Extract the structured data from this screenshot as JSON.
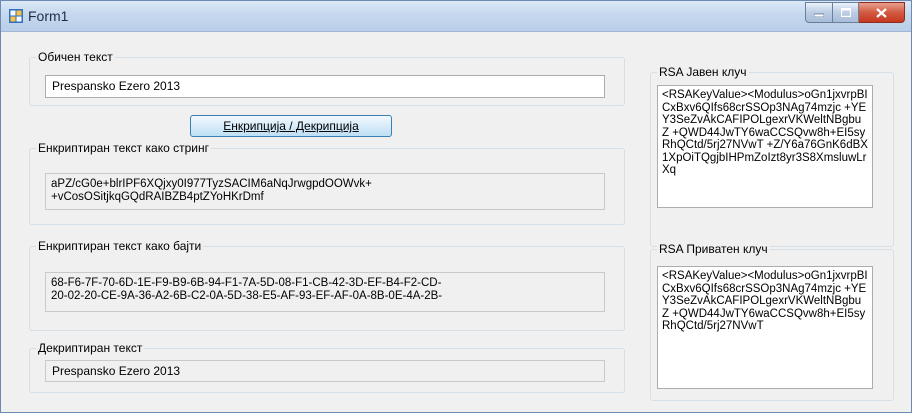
{
  "window": {
    "title": "Form1"
  },
  "plain_group": {
    "label": "Обичен текст",
    "value": "Prespansko Ezero 2013"
  },
  "encrypt_button": {
    "label": "Енкрипциjа / Декрипциjа"
  },
  "encrypted_string_group": {
    "label": "Енкриптиран текст како стринг",
    "lines": [
      "aPZ/cG0e+blrIPF6XQjxy0I977TyzSACIM6aNqJrwgpdOOWvk+",
      "+vCosOSitjkqGQdRAIBZB4ptZYoHKrDmf"
    ]
  },
  "encrypted_bytes_group": {
    "label": "Енкриптиран текст како бајти",
    "lines": [
      "68-F6-7F-70-6D-1E-F9-B9-6B-94-F1-7A-5D-08-F1-CB-42-3D-EF-B4-F2-CD-",
      "20-02-20-CE-9A-36-A2-6B-C2-0A-5D-38-E5-AF-93-EF-AF-0A-8B-0E-4A-2B-"
    ]
  },
  "decrypted_group": {
    "label": "Декриптиран текст",
    "value": "Prespansko Ezero 2013"
  },
  "public_key_group": {
    "label": "RSA Јавен клуч",
    "text": "<RSAKeyValue><Modulus>oGn1jxvrpBICxBxv6QIfs68crSSOp3NAg74mzjc\n+YEY3SeZvAkCAFIPOLgexrVKWeltNBgbuZ\n+QWD44JwTY6waCCSQvw8h+EI5syRhQCtd/5rj27NVwT\n+Z/Y6a76GnK6dBX1XpOiTQgjbIHPmZoIzt8yr3S8XmsluwLrXq"
  },
  "private_key_group": {
    "label": "RSA Приватен клуч",
    "text": "<RSAKeyValue><Modulus>oGn1jxvrpBICxBxv6QIfs68crSSOp3NAg74mzjc\n+YEY3SeZvAkCAFIPOLgexrVKWeltNBgbuZ\n+QWD44JwTY6waCCSQvw8h+EI5syRhQCtd/5rj27NVwT"
  }
}
